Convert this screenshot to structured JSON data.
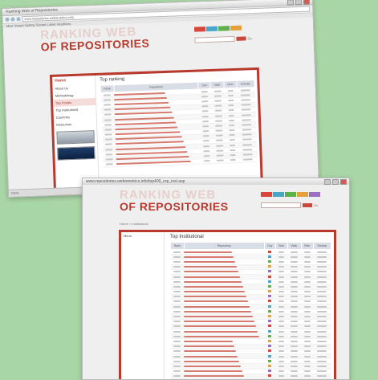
{
  "window1": {
    "title": "Ranking Web of Repositories",
    "url": "www.repositories.webometrics.info",
    "bookmarks": "Most Visited   Getting Started   Latest Headlines",
    "logo_line1": "RANKING WEB",
    "logo_line2": "OF REPOSITORIES",
    "search_label": "Go",
    "section_title": "Top ranking",
    "status": "Done",
    "sidebar": [
      "Home",
      "About Us",
      "Methodology",
      "Top Portals",
      "Top Institutional",
      "Countries",
      "Resources"
    ],
    "table_headers": [
      "Rank",
      "Repository",
      "Size",
      "Visib.",
      "Rich",
      "Scholar"
    ],
    "rows": 15
  },
  "window2": {
    "title": "Ranking Web of Repositories",
    "url": "www.repositories.webometrics.info/top400_rep_inst.asp",
    "logo_line1": "RANKING WEB",
    "logo_line2": "OF REPOSITORIES",
    "search_label": "Go",
    "breadcrumb": "Home > Institutional",
    "section_title": "Top Institutional",
    "sidebar_label": "Menu",
    "table_headers": [
      "Rank",
      "Repository",
      "Ctry",
      "Size",
      "Visib.",
      "Rich",
      "Scholar"
    ],
    "rows": 26
  },
  "colors": {
    "background": "#a9d6a6",
    "accent": "#b83a2e",
    "tab_colors": [
      "#d9473a",
      "#48a6c9",
      "#5fb04a",
      "#e5a13a",
      "#9a6fc0"
    ]
  }
}
